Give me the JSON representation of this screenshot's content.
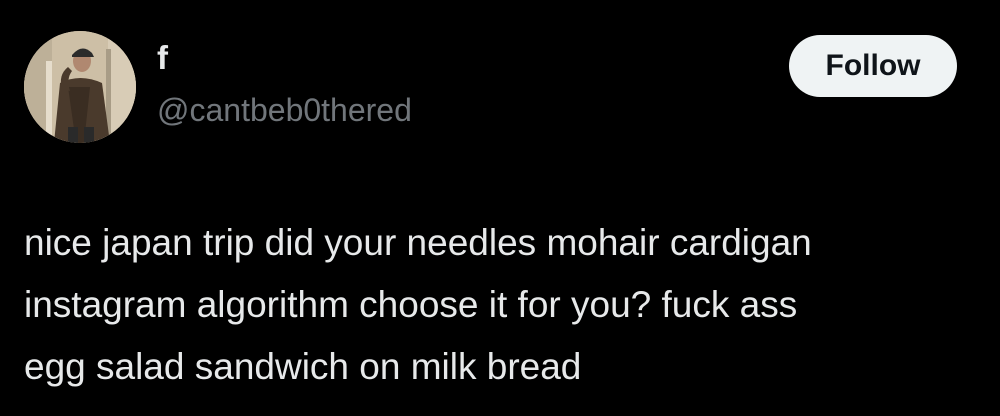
{
  "author": {
    "display_name": "f",
    "handle": "@cantbeb0thered",
    "avatar_icon": "person-photo-avatar"
  },
  "follow_button": {
    "label": "Follow"
  },
  "tweet": {
    "lines": [
      "nice japan trip did your needles mohair cardigan",
      "instagram algorithm choose it for you? fuck ass",
      "egg salad sandwich on milk bread"
    ]
  },
  "colors": {
    "background": "#000000",
    "primary_text": "#e7e9ea",
    "secondary_text": "#71767b",
    "button_bg": "#eff3f4",
    "button_text": "#0f1419"
  }
}
